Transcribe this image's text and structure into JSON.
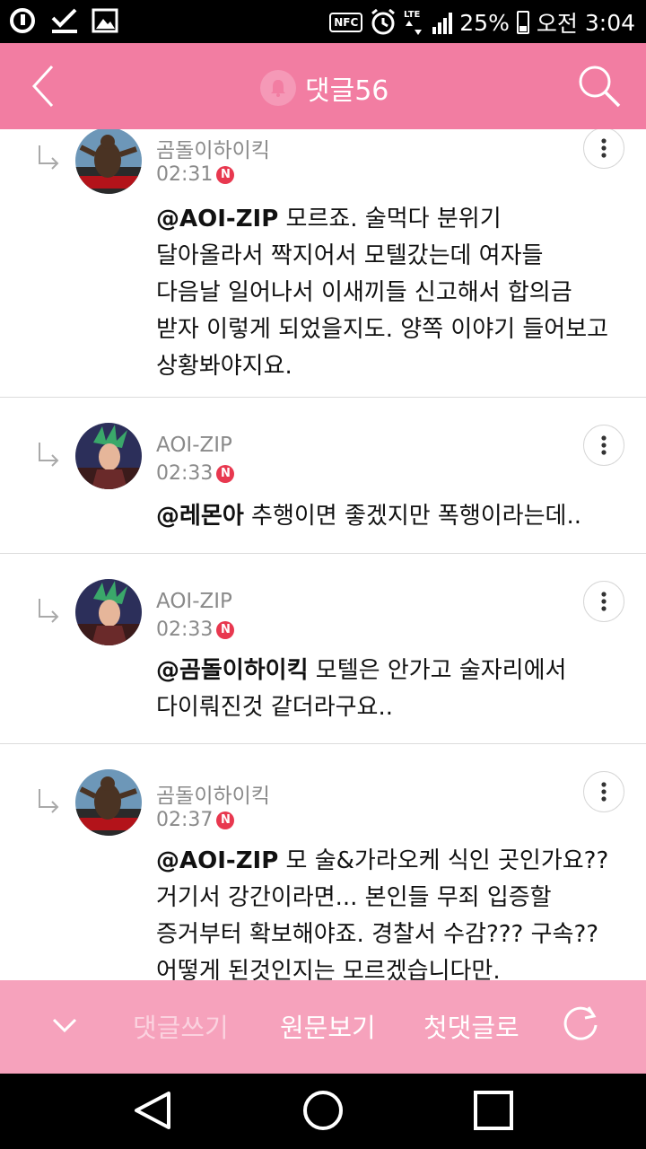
{
  "status_bar": {
    "nfc": "NFC",
    "battery": "25%",
    "ampm": "오전",
    "time": "3:04",
    "battery_level": 0.25
  },
  "header": {
    "title": "댓글56",
    "bg_color": "#f27da2",
    "icons": {
      "back": "chevron-left-icon",
      "bell": "bell-icon",
      "search": "search-icon"
    }
  },
  "comments": [
    {
      "author": "곰돌이하이킥",
      "time": "02:31",
      "badge": "N",
      "mention": "@AOI-ZIP",
      "text": " 모르죠. 술먹다 분위기 달아올라서 짝지어서 모텔갔는데 여자들 다음날 일어나서 이새끼들 신고해서 합의금 받자 이렇게 되었을지도. 양쪽 이야기 들어보고 상황봐야지요."
    },
    {
      "author": "AOI-ZIP",
      "time": "02:33",
      "badge": "N",
      "mention": "@레몬아",
      "text": " 추행이면 좋겠지만 폭행이라는데.."
    },
    {
      "author": "AOI-ZIP",
      "time": "02:33",
      "badge": "N",
      "mention": "@곰돌이하이킥",
      "text": " 모텔은 안가고 술자리에서 다이뤄진것 같더라구요.."
    },
    {
      "author": "곰돌이하이킥",
      "time": "02:37",
      "badge": "N",
      "mention": "@AOI-ZIP",
      "text": " 모 술&가라오케 식인 곳인가요?? 거기서 강간이라면... 본인들 무죄 입증할 증거부터 확보해야죠. 경찰서 수감??? 구속?? 어떻게 된것인지는 모르겠습니다만."
    }
  ],
  "action_bar": {
    "write": "댓글쓰기",
    "original": "원문보기",
    "first": "첫댓글로",
    "bg_color": "#f6a2bc"
  }
}
